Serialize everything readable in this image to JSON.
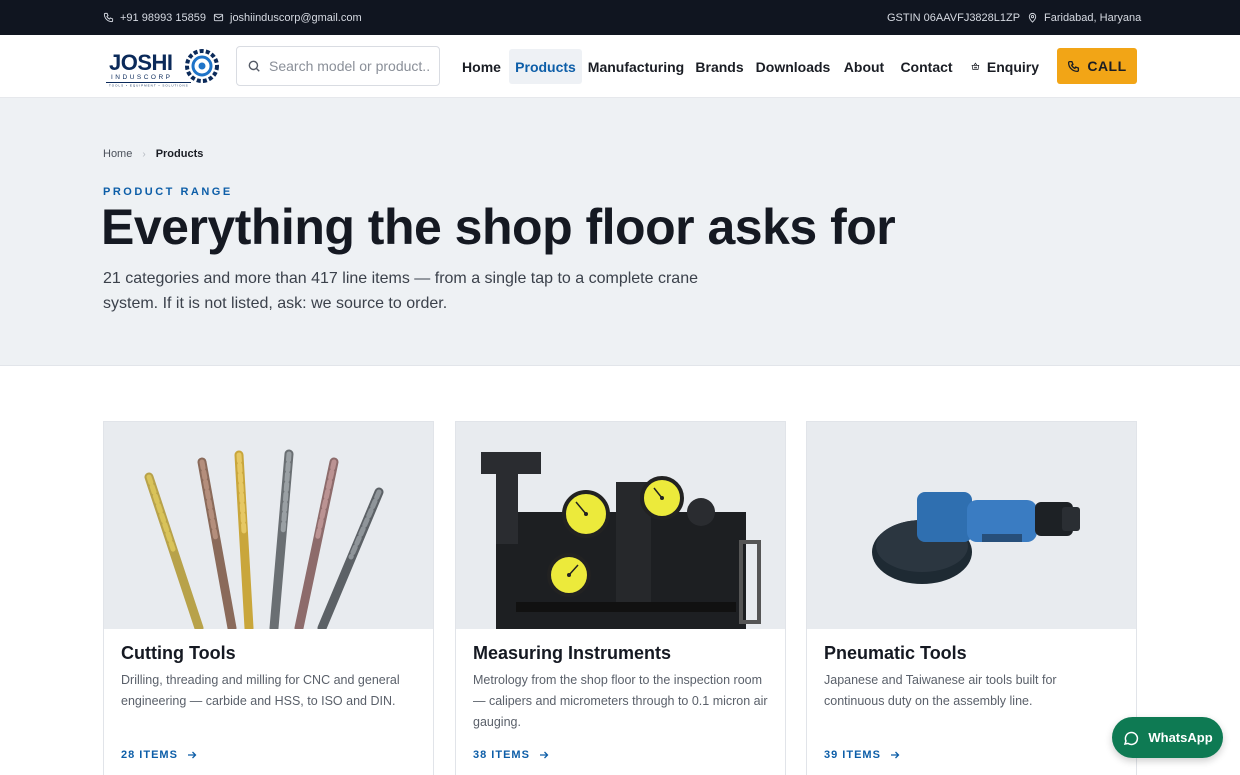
{
  "topbar": {
    "phone": "+91 98993 15859",
    "email": "joshiinduscorp@gmail.com",
    "gstin": "GSTIN 06AAVFJ3828L1ZP",
    "location": "Faridabad, Haryana"
  },
  "header": {
    "logo_text": "JOSHI INDUSCORP",
    "logo_tagline": "TOOLS • EQUIPMENT • SOLUTIONS",
    "search_placeholder": "Search model or product...",
    "nav": [
      {
        "label": "Home"
      },
      {
        "label": "Products",
        "active": true
      },
      {
        "label": "Manufacturing"
      },
      {
        "label": "Brands"
      },
      {
        "label": "Downloads"
      },
      {
        "label": "About"
      },
      {
        "label": "Contact"
      },
      {
        "label": "Enquiry"
      }
    ],
    "call_label": "CALL"
  },
  "hero": {
    "breadcrumb": [
      "Home",
      "Products"
    ],
    "eyebrow": "PRODUCT RANGE",
    "title": "Everything the shop floor asks for",
    "subtitle": "21 categories and more than 417 line items — from a single tap to a complete crane system. If it is not listed, ask: we source to order."
  },
  "cards": [
    {
      "title": "Cutting Tools",
      "description": "Drilling, threading and milling for CNC and general engineering — carbide and HSS, to ISO and DIN.",
      "link": "28 ITEMS"
    },
    {
      "title": "Measuring Instruments",
      "description": "Metrology from the shop floor to the inspection room — calipers and micrometers through to 0.1 micron air gauging.",
      "link": "38 ITEMS"
    },
    {
      "title": "Pneumatic Tools",
      "description": "Japanese and Taiwanese air tools built for continuous duty on the assembly line.",
      "link": "39 ITEMS"
    }
  ],
  "whatsapp_label": "WhatsApp",
  "colors": {
    "topbar_bg": "#101520",
    "accent_blue": "#0d5ea8",
    "call_orange": "#f2a516",
    "whatsapp_green": "#0e7a53",
    "hero_bg": "#eef1f4"
  }
}
